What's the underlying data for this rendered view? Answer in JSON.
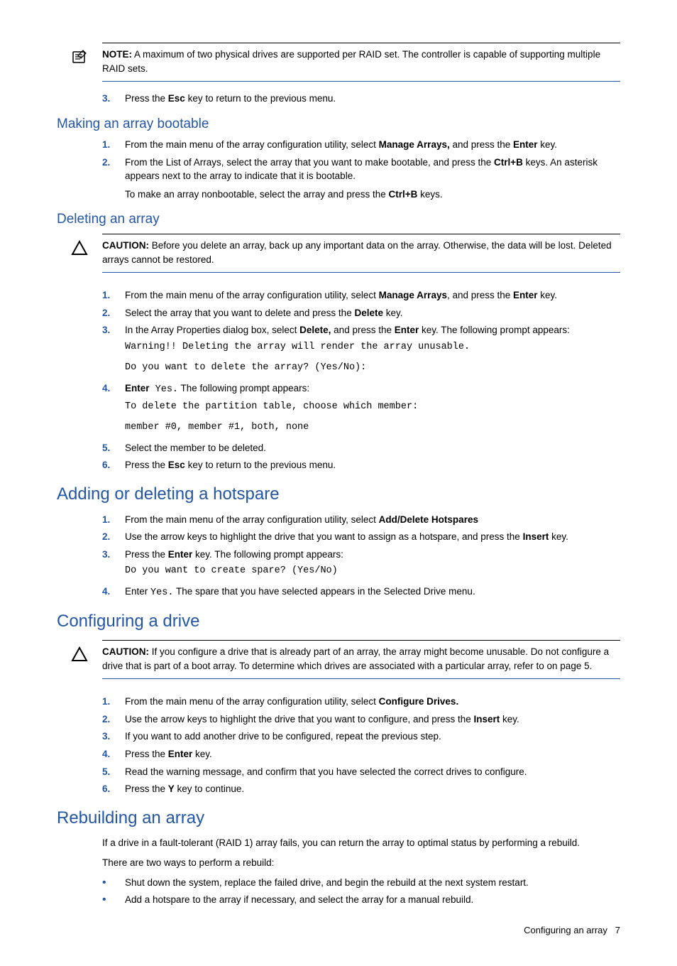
{
  "note1": {
    "label": "NOTE:",
    "text": "A maximum of two physical drives are supported per RAID set. The controller is capable of supporting multiple RAID sets."
  },
  "step3_top": {
    "num": "3.",
    "pre": "Press the ",
    "b1": "Esc",
    "post": " key to return to the previous menu."
  },
  "making_bootable": {
    "heading": "Making an array bootable",
    "s1": {
      "num": "1.",
      "t1": "From the main menu of the array configuration utility, select ",
      "b1": "Manage Arrays,",
      "t2": " and press the ",
      "b2": "Enter",
      "t3": " key."
    },
    "s2": {
      "num": "2.",
      "t1": "From the List of Arrays, select the array that you want to make bootable, and press the ",
      "b1": "Ctrl+B",
      "t2": " keys. An asterisk appears next to the array to indicate that it is bootable.",
      "t3": "To make an array nonbootable, select the array and press the ",
      "b2": "Ctrl+B",
      "t4": " keys."
    }
  },
  "deleting": {
    "heading": "Deleting an array",
    "caution": {
      "label": "CAUTION:",
      "text": "Before you delete an array, back up any important data on the array. Otherwise, the data will be lost. Deleted arrays cannot be restored."
    },
    "s1": {
      "num": "1.",
      "t1": "From the main menu of the array configuration utility, select ",
      "b1": "Manage Arrays",
      "t2": ", and press the ",
      "b2": "Enter",
      "t3": " key."
    },
    "s2": {
      "num": "2.",
      "t1": "Select the array that you want to delete and press the ",
      "b1": "Delete",
      "t2": " key."
    },
    "s3": {
      "num": "3.",
      "t1": "In the Array Properties dialog box, select ",
      "b1": "Delete,",
      "t2": " and press the ",
      "b2": "Enter",
      "t3": " key. The following prompt appears:",
      "code1": "Warning!! Deleting the array will render the array unusable.",
      "code2": "Do you want to delete the array? (Yes/No):"
    },
    "s4": {
      "num": "4.",
      "b1": "Enter",
      "c1": " Yes.",
      "t1": " The following prompt appears:",
      "code1": "To delete the partition table, choose which member:",
      "code2": "member #0, member #1, both, none"
    },
    "s5": {
      "num": "5.",
      "t1": "Select the member to be deleted."
    },
    "s6": {
      "num": "6.",
      "t1": "Press the ",
      "b1": "Esc",
      "t2": " key to return to the previous menu."
    }
  },
  "hotspare": {
    "heading": "Adding or deleting a hotspare",
    "s1": {
      "num": "1.",
      "t1": "From the main menu of the array configuration utility, select ",
      "b1": "Add/Delete Hotspares"
    },
    "s2": {
      "num": "2.",
      "t1": "Use the arrow keys to highlight the drive that you want to assign as a hotspare, and press the ",
      "b1": "Insert",
      "t2": " key."
    },
    "s3": {
      "num": "3.",
      "t1": "Press the ",
      "b1": "Enter",
      "t2": " key. The following prompt appears:",
      "code1": "Do you want to create spare? (Yes/No)"
    },
    "s4": {
      "num": "4.",
      "t1": "Enter ",
      "c1": "Yes.",
      "t2": " The spare that you have selected appears in the Selected Drive menu."
    }
  },
  "configuring": {
    "heading": "Configuring a drive",
    "caution": {
      "label": "CAUTION:",
      "text": "If you configure a drive that is already part of an array, the array might become unusable. Do not configure a drive that is part of a boot array. To determine which drives are associated with a particular array, refer to on page 5."
    },
    "s1": {
      "num": "1.",
      "t1": "From the main menu of the array configuration utility, select ",
      "b1": "Configure Drives."
    },
    "s2": {
      "num": "2.",
      "t1": "Use the arrow keys to highlight the drive that you want to configure, and press the ",
      "b1": "Insert",
      "t2": " key."
    },
    "s3": {
      "num": "3.",
      "t1": "If you want to add another drive to be configured, repeat the previous step."
    },
    "s4": {
      "num": "4.",
      "t1": "Press the ",
      "b1": "Enter",
      "t2": " key."
    },
    "s5": {
      "num": "5.",
      "t1": "Read the warning message, and confirm that you have selected the correct drives to configure."
    },
    "s6": {
      "num": "6.",
      "t1": "Press the ",
      "b1": "Y",
      "t2": " key to continue."
    }
  },
  "rebuilding": {
    "heading": "Rebuilding an array",
    "p1": "If a drive in a fault-tolerant (RAID 1) array fails, you can return the array to optimal status by performing a rebuild.",
    "p2": "There are two ways to perform a rebuild:",
    "b1": "Shut down the system, replace the failed drive, and begin the rebuild at the next system restart.",
    "b2": "Add a hotspare to the array if necessary, and select the array for a manual rebuild."
  },
  "footer": {
    "text": "Configuring an array",
    "page": "7"
  }
}
